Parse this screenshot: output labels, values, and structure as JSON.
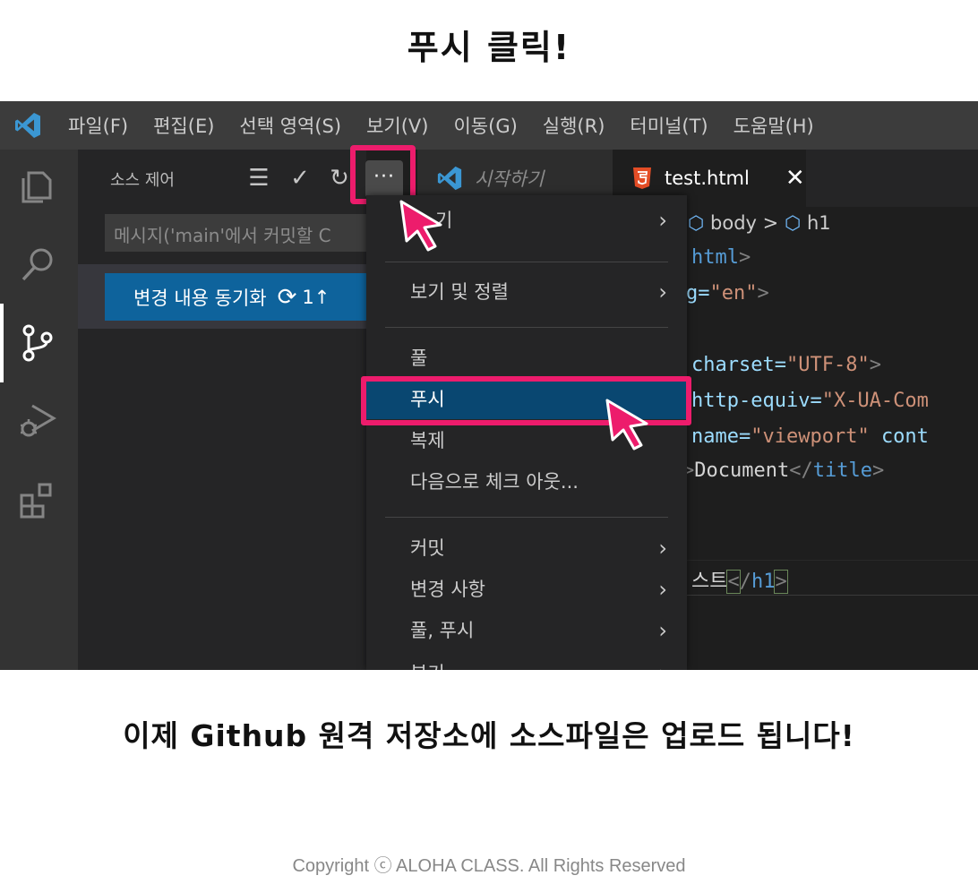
{
  "captions": {
    "top": "푸시 클릭!",
    "bottom": "이제 Github 원격 저장소에 소스파일은 업로드 됩니다!",
    "copyright": "Copyright ⓒ ALOHA CLASS. All Rights Reserved"
  },
  "menubar": {
    "items": [
      "파일(F)",
      "편집(E)",
      "선택 영역(S)",
      "보기(V)",
      "이동(G)",
      "실행(R)",
      "터미널(T)",
      "도움말(H)"
    ]
  },
  "sidebar": {
    "title": "소스 제어",
    "actions": {
      "view_as_tree": "☰",
      "commit": "✓",
      "refresh": "↻",
      "more": "···"
    },
    "commit_placeholder": "메시지('main'에서 커밋할 C",
    "sync_button": {
      "label": "변경 내용 동기화",
      "icon": "⟳",
      "count": "1↑"
    }
  },
  "tabs": [
    {
      "label": "시작하기",
      "icon": "vscode-logo-icon"
    },
    {
      "label": "test.html",
      "icon": "html5-icon",
      "close": "✕"
    }
  ],
  "editor": {
    "breadcrumb": {
      "sep": ">",
      "parts": [
        "body",
        "h1"
      ]
    },
    "lines": {
      "l1_tag": "html",
      "l2_attr": "g=",
      "l2_value": "\"en\"",
      "l3_attr": "charset=",
      "l3_value": "\"UTF-8\"",
      "l4_attr": "http-equiv=",
      "l4_value": "\"X-UA-Com",
      "l5_attr": "name=",
      "l5_value": "\"viewport\"",
      "l5_attr2": "cont",
      "l6_text": "Document",
      "l6_tag": "title",
      "l7_text": "스트",
      "l7_tag": "h1"
    }
  },
  "dropdown": {
    "items": [
      {
        "label": "기",
        "submenu": true
      },
      {
        "label": "보기 및 정렬",
        "submenu": true
      },
      {
        "label": "풀",
        "submenu": false
      },
      {
        "label": "푸시",
        "submenu": false,
        "selected": true
      },
      {
        "label": "복제",
        "submenu": false
      },
      {
        "label": "다음으로 체크 아웃...",
        "submenu": false
      },
      {
        "label": "커밋",
        "submenu": true
      },
      {
        "label": "변경 사항",
        "submenu": true
      },
      {
        "label": "풀, 푸시",
        "submenu": true
      },
      {
        "label": "분기",
        "submenu": true
      }
    ],
    "chevron": "›"
  },
  "colors": {
    "highlight": "#ed1c6c",
    "selection": "#094771",
    "button": "#0e639c",
    "vscode_blue": "#3b97d3",
    "html5_orange": "#e44d26"
  }
}
